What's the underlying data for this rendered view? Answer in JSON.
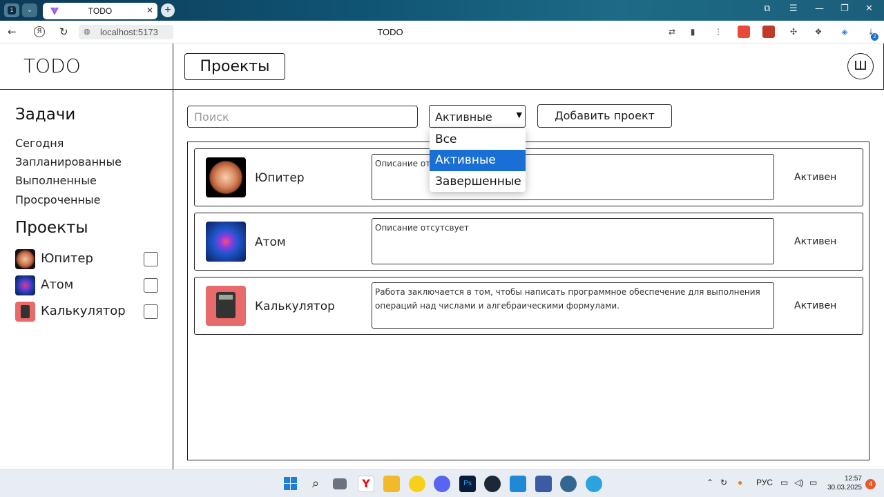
{
  "browser": {
    "workspace_number": "1",
    "tab_title": "TODO",
    "tab_close": "✕",
    "new_tab": "+",
    "url": "localhost:5173",
    "page_title": "TODO",
    "nav": {
      "back": "←",
      "yandex": "Я",
      "reload": "↻"
    },
    "window_controls": [
      "⧉",
      "☰",
      "—",
      "❐",
      "✕"
    ],
    "ext_badge": "2"
  },
  "app": {
    "logo": "TODO",
    "header_button": "Проекты",
    "avatar_letter": "Ш"
  },
  "sidebar": {
    "tasks_heading": "Задачи",
    "task_links": [
      "Сегодня",
      "Запланированные",
      "Выполненные",
      "Просроченные"
    ],
    "projects_heading": "Проекты",
    "projects": [
      {
        "name": "Юпитер",
        "icon": "jupiter-icon"
      },
      {
        "name": "Атом",
        "icon": "atom-icon"
      },
      {
        "name": "Калькулятор",
        "icon": "calculator-icon"
      }
    ]
  },
  "toolbar": {
    "search_placeholder": "Поиск",
    "filter_value": "Активные",
    "add_project": "Добавить проект"
  },
  "filter_dropdown": {
    "options": [
      "Все",
      "Активные",
      "Завершенные"
    ],
    "selected": "Активные"
  },
  "projects": [
    {
      "name": "Юпитер",
      "description": "Описание отсутсвует",
      "status": "Активен"
    },
    {
      "name": "Атом",
      "description": "Описание отсутсвует",
      "status": "Активен"
    },
    {
      "name": "Калькулятор",
      "description": "Работа заключается в том, чтобы написать программное обеспечение для выполнения операций над числами и алгебраическими формулами.",
      "status": "Активен"
    }
  ],
  "taskbar": {
    "language": "РУС",
    "time": "12:57",
    "date": "30.03.2025",
    "notification_count": "4"
  },
  "colors": {
    "accent": "#1a6fd6",
    "tabbar": "#105373",
    "border": "#222222"
  }
}
